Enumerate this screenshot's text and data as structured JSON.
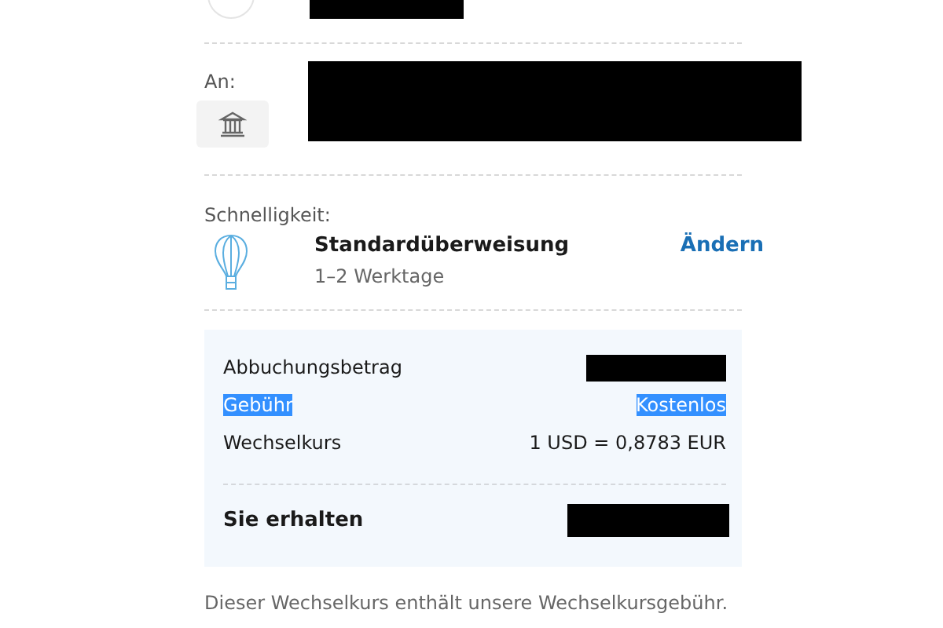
{
  "recipient": {
    "label": "An:"
  },
  "speed": {
    "label": "Schnelligkeit:",
    "title": "Standardüberweisung",
    "subtitle": "1–2 Werktage",
    "action": "Ändern"
  },
  "summary": {
    "rows": [
      {
        "label": "Abbuchungsbetrag",
        "kind": "redacted",
        "selected": false
      },
      {
        "label": "Gebühr",
        "value": "Kostenlos",
        "kind": "text",
        "selected": true
      },
      {
        "label": "Wechselkurs",
        "value": "1 USD = 0,8783 EUR",
        "kind": "text",
        "selected": false
      }
    ],
    "total": {
      "label": "Sie erhalten"
    }
  },
  "note": "Dieser Wechselkurs enthält unsere Wechselkursgebühr."
}
